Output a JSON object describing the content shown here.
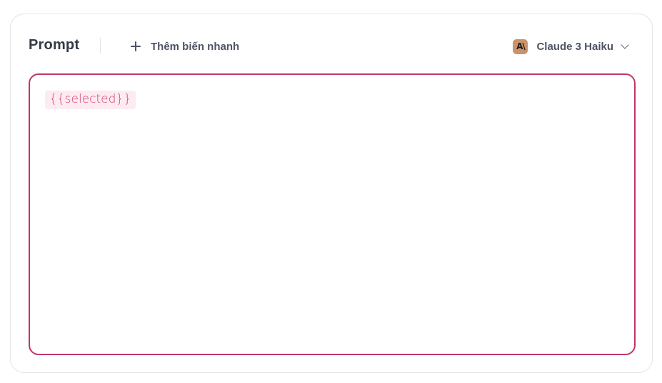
{
  "prompt_panel": {
    "title": "Prompt",
    "add_variable_label": "Thêm biến nhanh",
    "model": {
      "name": "Claude 3 Haiku",
      "logo_text": "A\\",
      "logo_color": "#c9946d"
    },
    "editor": {
      "variable_chip": "{{selected}}",
      "border_color": "#c2346b"
    }
  },
  "icons": {
    "add": "plus-icon",
    "model_logo": "anthropic-logo-icon",
    "dropdown": "chevron-down-icon"
  }
}
